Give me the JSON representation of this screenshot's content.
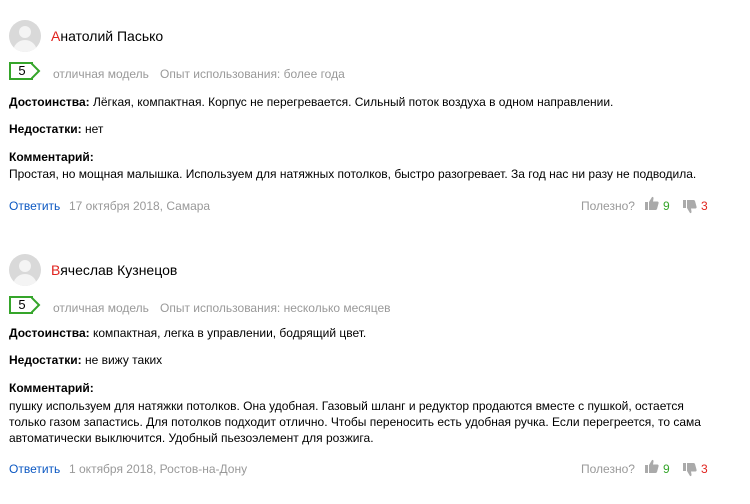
{
  "reviews": [
    {
      "author_initial": "А",
      "author_rest": "натолий Пасько",
      "rating": "5",
      "grade_label": "отличная модель",
      "usage": "Опыт использования: более года",
      "pros_label": "Достоинства:",
      "pros": "Лёгкая, компактная. Корпус не перегревается. Сильный поток воздуха в одном направлении.",
      "cons_label": "Недостатки:",
      "cons": "нет",
      "comment_label": "Комментарий:",
      "comment": "Простая, но мощная малышка. Используем для натяжных потолков, быстро разогревает. За год нас ни разу не подводила.",
      "reply_label": "Ответить",
      "date_place": "17 октября 2018, Самара",
      "helpful_label": "Полезно?",
      "likes": "9",
      "dislikes": "3"
    },
    {
      "author_initial": "В",
      "author_rest": "ячеслав Кузнецов",
      "rating": "5",
      "grade_label": "отличная модель",
      "usage": "Опыт использования: несколько месяцев",
      "pros_label": "Достоинства:",
      "pros": "компактная, легка в управлении, бодрящий цвет.",
      "cons_label": "Недостатки:",
      "cons": "не вижу таких",
      "comment_label": "Комментарий:",
      "comment": "пушку используем для натяжки потолков. Она удобная. Газовый шланг и редуктор продаются вместе с пушкой, остается только газом запастись. Для потолков подходит отлично. Чтобы переносить есть удобная ручка. Если перегреется, то сама автоматически выключится. Удобный пьезоэлемент для розжига.",
      "reply_label": "Ответить",
      "date_place": "1 октября 2018, Ростов-на-Дону",
      "helpful_label": "Полезно?",
      "likes": "9",
      "dislikes": "3"
    }
  ],
  "colors": {
    "accent_red": "#e0231e",
    "rating_green": "#35a52a",
    "link_blue": "#0a57c2",
    "muted_gray": "#999999"
  },
  "icons": [
    "avatar-placeholder",
    "thumbs-up-icon",
    "thumbs-down-icon"
  ]
}
